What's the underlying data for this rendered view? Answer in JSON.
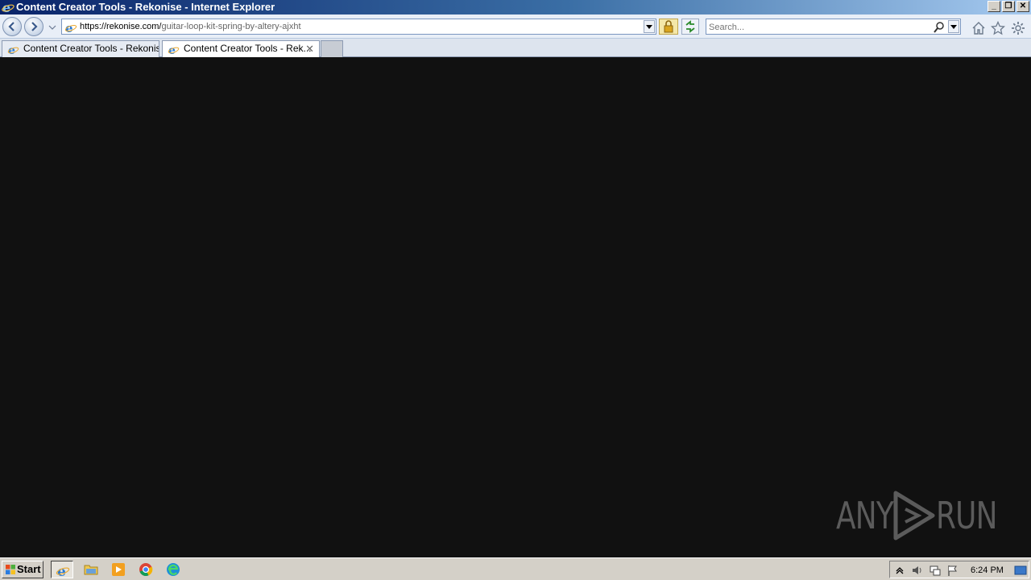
{
  "window": {
    "title": "Content Creator Tools - Rekonise - Internet Explorer",
    "controls": [
      "minimize",
      "restore",
      "close"
    ]
  },
  "navbar": {
    "url_host": "https://rekonise.com/",
    "url_path": "guitar-loop-kit-spring-by-altery-ajxht",
    "search_placeholder": "Search...",
    "icons": [
      "back-icon",
      "forward-icon",
      "lock-icon",
      "refresh-icon",
      "search-icon",
      "home-icon",
      "favorites-star-icon",
      "settings-gear-icon"
    ]
  },
  "tabs": [
    {
      "label": "Content Creator Tools - Rekonise",
      "active": false
    },
    {
      "label": "Content Creator Tools - Rek...",
      "active": true,
      "close": "✕"
    }
  ],
  "watermark": {
    "left": "ANY",
    "right": "RUN"
  },
  "taskbar": {
    "start_label": "Start",
    "apps": [
      "internet-explorer",
      "file-explorer",
      "media-player",
      "chrome",
      "edge"
    ],
    "clock": "6:24 PM"
  },
  "colors": {
    "content_bg": "#111111",
    "taskbar": "#d4d0c8",
    "titlebar": "#0a246a"
  }
}
